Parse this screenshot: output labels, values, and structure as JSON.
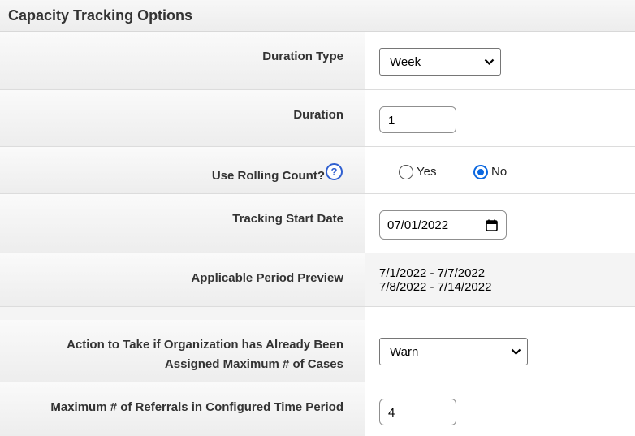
{
  "header": {
    "title": "Capacity Tracking Options"
  },
  "fields": {
    "duration_type": {
      "label": "Duration Type",
      "value": "Week"
    },
    "duration": {
      "label": "Duration",
      "value": "1"
    },
    "rolling_count": {
      "label": "Use Rolling Count?",
      "help_icon": "?",
      "yes_label": "Yes",
      "no_label": "No",
      "selected": "No"
    },
    "tracking_start_date": {
      "label": "Tracking Start Date",
      "value": "07/01/2022"
    },
    "period_preview": {
      "label": "Applicable Period Preview",
      "lines": [
        "7/1/2022 - 7/7/2022",
        "7/8/2022 - 7/14/2022"
      ]
    },
    "action_if_max": {
      "label_line1": "Action to Take if Organization has Already Been",
      "label_line2": "Assigned Maximum # of Cases",
      "value": "Warn"
    },
    "max_referrals": {
      "label": "Maximum # of Referrals in Configured Time Period",
      "value": "4"
    }
  },
  "colors": {
    "accent": "#0a67e0",
    "help_icon": "#2f5fd0"
  },
  "icons": {
    "dropdown": "chevron-down-icon",
    "calendar": "calendar-icon",
    "help": "help-icon"
  }
}
